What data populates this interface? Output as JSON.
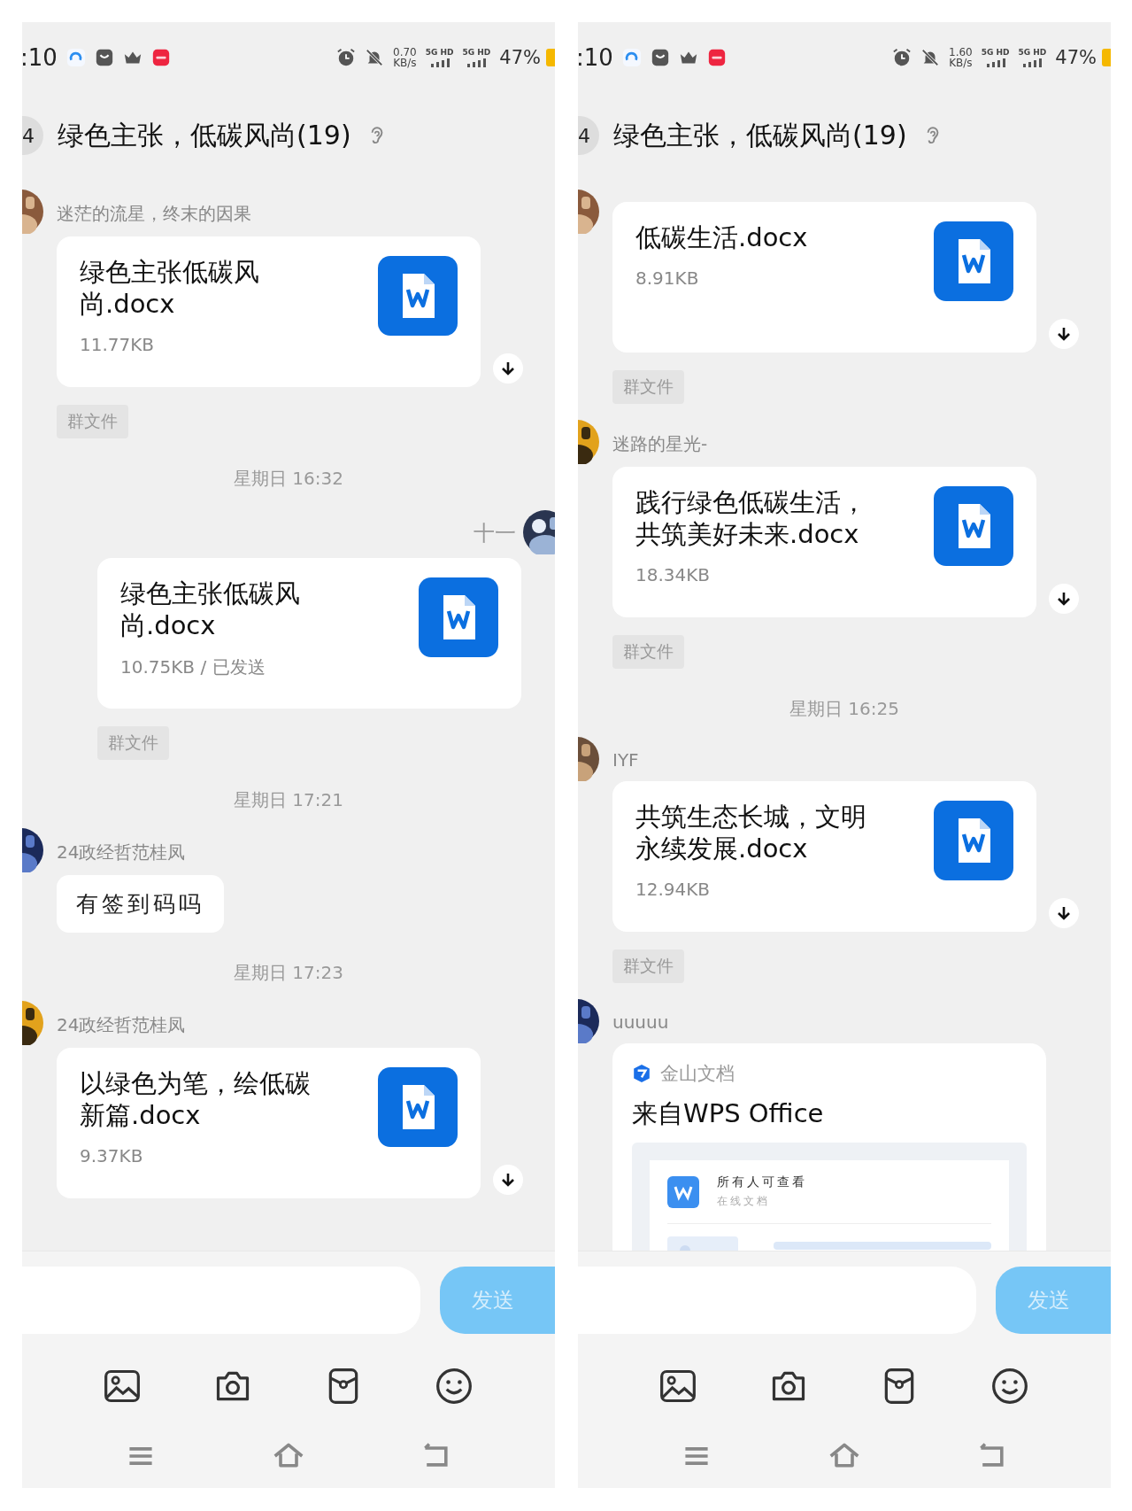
{
  "panels": [
    {
      "status_bar": {
        "time": ":10",
        "speed": "0.70",
        "speed_unit": "KB/s",
        "networks": [
          "5G HD",
          "5G HD"
        ],
        "battery": "47%"
      },
      "header": {
        "badge": "4",
        "title": "绿色主张，低碳风尚(19)"
      },
      "messages": [
        {
          "kind": "file",
          "sender": "迷茫的流星，终末的因果",
          "outgoing": false,
          "name": "绿色主张低碳风尚.docx",
          "size": "11.77KB",
          "download": true,
          "tag": "群文件"
        },
        {
          "kind": "time",
          "text": "星期日 16:32"
        },
        {
          "kind": "file",
          "sender": "十一",
          "outgoing": true,
          "name": "绿色主张低碳风尚.docx",
          "size": "10.75KB / 已发送",
          "download": false,
          "tag": "群文件"
        },
        {
          "kind": "time",
          "text": "星期日 17:21"
        },
        {
          "kind": "text",
          "sender": "24政经哲范桂凤",
          "outgoing": false,
          "text": "有签到码吗"
        },
        {
          "kind": "time",
          "text": "星期日 17:23"
        },
        {
          "kind": "file",
          "sender": "24政经哲范桂凤",
          "outgoing": false,
          "name": "以绿色为笔，绘低碳新篇.docx",
          "size": "9.37KB",
          "download": true
        }
      ],
      "composer": {
        "send": "发送"
      }
    },
    {
      "status_bar": {
        "time": ":10",
        "speed": "1.60",
        "speed_unit": "KB/s",
        "networks": [
          "5G HD",
          "5G HD"
        ],
        "battery": "47%"
      },
      "header": {
        "badge": "4",
        "title": "绿色主张，低碳风尚(19)"
      },
      "messages": [
        {
          "kind": "file",
          "outgoing": false,
          "name": "低碳生活.docx",
          "size": "8.91KB",
          "download": true,
          "tag": "群文件"
        },
        {
          "kind": "file",
          "sender": "迷路的星光-",
          "outgoing": false,
          "name": "践行绿色低碳生活，共筑美好未来.docx",
          "size": "18.34KB",
          "download": true,
          "tag": "群文件"
        },
        {
          "kind": "time",
          "text": "星期日 16:25"
        },
        {
          "kind": "file",
          "sender": "IYF",
          "outgoing": false,
          "name": "共筑生态长城，文明永续发展.docx",
          "size": "12.94KB",
          "download": true,
          "tag": "群文件"
        },
        {
          "kind": "link",
          "sender": "uuuuu",
          "outgoing": false,
          "source": "金山文档",
          "title": "来自WPS Office",
          "preview_title": "所有人可查看",
          "preview_subtitle": "在线文档"
        }
      ],
      "composer": {
        "send": "发送"
      }
    }
  ]
}
